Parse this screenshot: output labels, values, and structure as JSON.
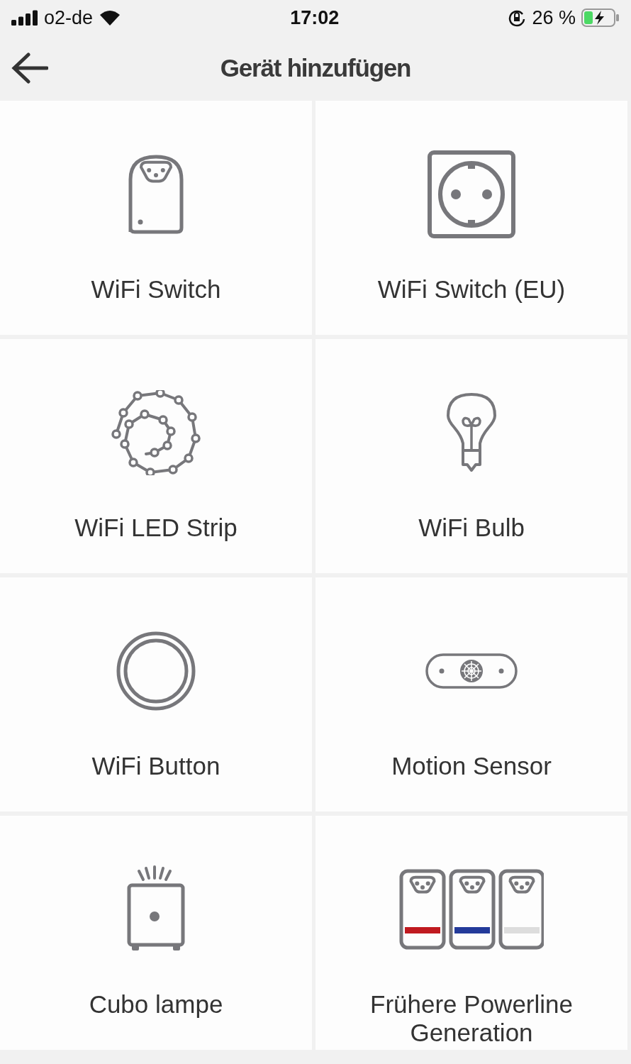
{
  "status_bar": {
    "carrier": "o2-de",
    "time": "17:02",
    "battery": "26 %"
  },
  "header": {
    "title": "Gerät hinzufügen"
  },
  "devices": [
    {
      "kind": "plug",
      "label": "WiFi Switch"
    },
    {
      "kind": "socket",
      "label": "WiFi Switch (EU)"
    },
    {
      "kind": "strip",
      "label": "WiFi LED Strip"
    },
    {
      "kind": "bulb",
      "label": "WiFi Bulb"
    },
    {
      "kind": "button",
      "label": "WiFi Button"
    },
    {
      "kind": "motion",
      "label": "Motion Sensor"
    },
    {
      "kind": "lamp",
      "label": "Cubo lampe"
    },
    {
      "kind": "powerline",
      "label": "Frühere Powerline Generation"
    }
  ]
}
